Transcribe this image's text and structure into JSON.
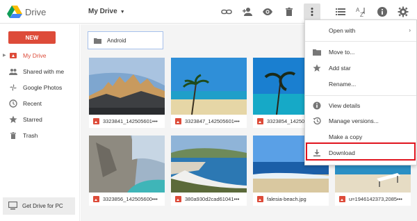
{
  "app": {
    "title": "Drive"
  },
  "header": {
    "location": "My Drive"
  },
  "toolbar_icons": [
    "link-icon",
    "share-person-icon",
    "preview-eye-icon",
    "trash-icon",
    "more-vert-icon",
    "list-view-icon",
    "sort-az-icon",
    "info-icon",
    "settings-gear-icon"
  ],
  "sidebar": {
    "new_label": "NEW",
    "items": [
      {
        "label": "My Drive",
        "icon": "drive-icon"
      },
      {
        "label": "Shared with me",
        "icon": "people-icon"
      },
      {
        "label": "Google Photos",
        "icon": "pinwheel-icon"
      },
      {
        "label": "Recent",
        "icon": "clock-icon"
      },
      {
        "label": "Starred",
        "icon": "star-icon"
      },
      {
        "label": "Trash",
        "icon": "trash-icon"
      }
    ],
    "get_drive_label": "Get Drive for PC"
  },
  "main": {
    "folders": [
      {
        "label": "Android"
      }
    ],
    "files": [
      {
        "name": "3323841_142505601•••"
      },
      {
        "name": "3323847_142505601•••"
      },
      {
        "name": "3323854_142505601•••"
      },
      {
        "name": "3323856_142505600•••"
      },
      {
        "name": "380a930d2cad61041•••"
      },
      {
        "name": "falesia-beach.jpg"
      },
      {
        "name": "u=1946142373,2085•••"
      }
    ]
  },
  "context_menu": {
    "items": [
      {
        "label": "Open with",
        "icon": "",
        "submenu": "›"
      },
      {
        "label": "Move to...",
        "icon": "folder-icon"
      },
      {
        "label": "Add star",
        "icon": "star-icon"
      },
      {
        "label": "Rename...",
        "icon": ""
      },
      {
        "label": "View details",
        "icon": "info-icon"
      },
      {
        "label": "Manage versions...",
        "icon": "history-icon"
      },
      {
        "label": "Make a copy",
        "icon": ""
      },
      {
        "label": "Download",
        "icon": "download-icon"
      }
    ]
  },
  "colors": {
    "accent": "#dd4b39",
    "highlight": "#e0141e",
    "selected_folder_border": "#a6c0eb"
  }
}
